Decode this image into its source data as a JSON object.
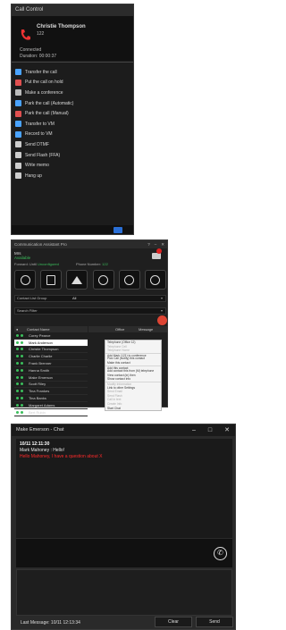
{
  "call_control": {
    "title": "Call Control",
    "caller_name": "Christie Thompson",
    "extension": "122",
    "status": "Connected",
    "duration_label": "Duration:",
    "duration_value": "00:00:37",
    "actions": [
      {
        "label": "Transfer the call",
        "icon": "transfer-icon",
        "color": "#4aa3ff"
      },
      {
        "label": "Put the call on hold",
        "icon": "hold-icon",
        "color": "#e05050"
      },
      {
        "label": "Make a conference",
        "icon": "conference-icon",
        "color": "#bbbbbb"
      },
      {
        "label": "Park the call (Automatic)",
        "icon": "park-auto-icon",
        "color": "#4aa3ff"
      },
      {
        "label": "Park the call (Manual)",
        "icon": "park-manual-icon",
        "color": "#e05050"
      },
      {
        "label": "Transfer to VM",
        "icon": "transfer-vm-icon",
        "color": "#4aa3ff"
      },
      {
        "label": "Record to VM",
        "icon": "record-vm-icon",
        "color": "#4aa3ff"
      },
      {
        "label": "Send DTMF",
        "icon": "dtmf-icon",
        "color": "#cccccc"
      },
      {
        "label": "Send Flash (FFA)",
        "icon": "flash-icon",
        "color": "#cccccc"
      },
      {
        "label": "Write memo",
        "icon": "memo-icon",
        "color": "#cccccc"
      },
      {
        "label": "Hang up",
        "icon": "hangup-icon",
        "color": "#cccccc"
      }
    ]
  },
  "assistant": {
    "title": "Communication Assistant Pro",
    "user": "Mrs",
    "availability": "Available",
    "line_label": "Forward: Until",
    "line_value": "Unconfigured",
    "phone_label": "Phone Number:",
    "phone_value": "122",
    "contact_list_label": "Contact List Group",
    "contact_list_value": "All",
    "search_label": "Search Filter",
    "columns": [
      "Contact Name",
      "Office",
      "Message"
    ],
    "contacts": [
      {
        "name": "Corey Pearce",
        "selected": false
      },
      {
        "name": "Mark Anderson",
        "selected": true
      },
      {
        "name": "Christie Thompson",
        "selected": false
      },
      {
        "name": "Charlie Charlie",
        "selected": false
      },
      {
        "name": "Frank Brenner",
        "selected": false
      },
      {
        "name": "Hanna Smith",
        "selected": false
      },
      {
        "name": "Make Emerson",
        "selected": false
      },
      {
        "name": "Scott Riley",
        "selected": false
      },
      {
        "name": "Tina Frankes",
        "selected": false
      },
      {
        "name": "Tina Banks",
        "selected": false
      },
      {
        "name": "Margaret Adams",
        "selected": false
      },
      {
        "name": "Bert Rubin",
        "selected": false
      }
    ],
    "menu": [
      {
        "label": "Telephone (Office 12)",
        "disabled": false,
        "sep": false
      },
      {
        "label": "Telephone Cell",
        "disabled": true,
        "sep": false
      },
      {
        "label": "Telephone Home",
        "disabled": true,
        "sep": false
      },
      {
        "label": "Add Mark (121) to conference",
        "disabled": false,
        "sep": true
      },
      {
        "label": "Pick Call (Notify) this contact",
        "disabled": false,
        "sep": false
      },
      {
        "label": "Make this contact",
        "disabled": false,
        "sep": false
      },
      {
        "label": "Add this contact",
        "disabled": false,
        "sep": true
      },
      {
        "label": "Add contact this from (M) telephone",
        "disabled": false,
        "sep": false
      },
      {
        "label": "View contact (in) then",
        "disabled": false,
        "sep": false
      },
      {
        "label": "Show contact info",
        "disabled": false,
        "sep": false
      },
      {
        "label": "Modify Information",
        "disabled": true,
        "sep": true
      },
      {
        "label": "Link to other Settings",
        "disabled": false,
        "sep": false
      },
      {
        "label": "Send Email",
        "disabled": true,
        "sep": false
      },
      {
        "label": "Send Flash",
        "disabled": true,
        "sep": false
      },
      {
        "label": "Call in text",
        "disabled": true,
        "sep": false
      },
      {
        "label": "Create Info",
        "disabled": true,
        "sep": false
      },
      {
        "label": "Start Chat",
        "disabled": false,
        "sep": false
      }
    ]
  },
  "chat": {
    "title": "Make Emerson - Chat",
    "timestamp": "10/11 12:11:30",
    "from": "Mark Mahoney : Hello!",
    "message": "Hello Mahoney, I have a question about X",
    "last_message_label": "Last Message:",
    "last_message_time": "10/11 12:13:34",
    "clear_label": "Clear",
    "send_label": "Send"
  }
}
